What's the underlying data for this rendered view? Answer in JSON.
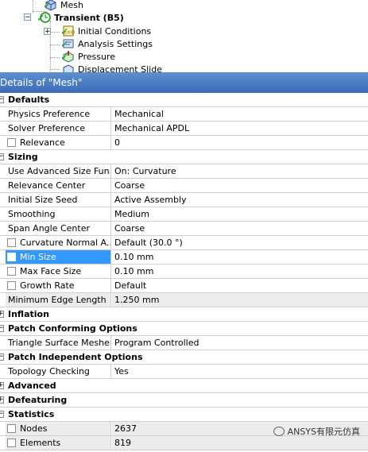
{
  "tree": {
    "mesh": "Mesh",
    "transient": "Transient (B5)",
    "initial_conditions": "Initial Conditions",
    "analysis_settings": "Analysis Settings",
    "pressure": "Pressure",
    "displacement": "Displacement Slide",
    "expand_plus": "+",
    "expand_minus": "−"
  },
  "details_title": "Details of \"Mesh\"",
  "categories": {
    "defaults": "Defaults",
    "sizing": "Sizing",
    "inflation": "Inflation",
    "patch_conforming": "Patch Conforming Options",
    "patch_independent": "Patch Independent Options",
    "advanced": "Advanced",
    "defeaturing": "Defeaturing",
    "statistics": "Statistics"
  },
  "rows": {
    "physics_pref": {
      "name": "Physics Preference",
      "value": "Mechanical"
    },
    "solver_pref": {
      "name": "Solver Preference",
      "value": "Mechanical APDL"
    },
    "relevance": {
      "name": "Relevance",
      "value": "0"
    },
    "adv_size": {
      "name": "Use Advanced Size Fun...",
      "value": "On: Curvature"
    },
    "relevance_center": {
      "name": "Relevance Center",
      "value": "Coarse"
    },
    "initial_seed": {
      "name": "Initial Size Seed",
      "value": "Active Assembly"
    },
    "smoothing": {
      "name": "Smoothing",
      "value": "Medium"
    },
    "span_angle": {
      "name": "Span Angle Center",
      "value": "Coarse"
    },
    "curv_normal": {
      "name": "Curvature Normal A...",
      "value": "Default (30.0 °)"
    },
    "min_size": {
      "name": "Min Size",
      "value": "0.10 mm"
    },
    "max_face": {
      "name": "Max Face Size",
      "value": "0.10 mm"
    },
    "growth": {
      "name": "Growth Rate",
      "value": "Default"
    },
    "min_edge": {
      "name": "Minimum Edge Length",
      "value": "1.250 mm"
    },
    "tri_mesher": {
      "name": "Triangle Surface Mesher",
      "value": "Program Controlled"
    },
    "topology": {
      "name": "Topology Checking",
      "value": "Yes"
    },
    "nodes": {
      "name": "Nodes",
      "value": "2637"
    },
    "elements": {
      "name": "Elements",
      "value": "819"
    }
  },
  "watermark": "ANSYS有限元仿真",
  "colors": {
    "header_blue": "#3d6cb8",
    "selection": "#3399ff",
    "check_green": "#19a319"
  }
}
